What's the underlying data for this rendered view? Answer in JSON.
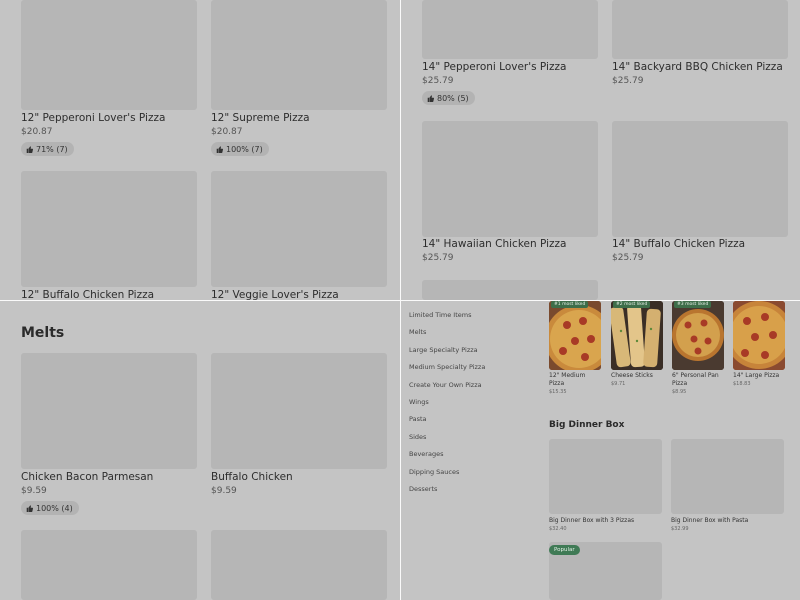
{
  "top_left": {
    "cards": [
      {
        "name": "12\" Pepperoni Lover's Pizza",
        "price": "$20.87",
        "rating": "71% (7)"
      },
      {
        "name": "12\" Supreme Pizza",
        "price": "$20.87",
        "rating": "100% (7)"
      },
      {
        "name": "12\" Buffalo Chicken Pizza"
      },
      {
        "name": "12\" Veggie Lover's Pizza"
      }
    ]
  },
  "top_right": {
    "cards": [
      {
        "name": "14\" Pepperoni Lover's Pizza",
        "price": "$25.79",
        "rating": "80% (5)"
      },
      {
        "name": "14\" Backyard BBQ Chicken Pizza",
        "price": "$25.79"
      },
      {
        "name": "14\" Hawaiian Chicken Pizza",
        "price": "$25.79"
      },
      {
        "name": "14\" Buffalo Chicken Pizza",
        "price": "$25.79"
      }
    ]
  },
  "bottom_left": {
    "section_title": "Melts",
    "cards": [
      {
        "name": "Chicken Bacon Parmesan",
        "price": "$9.59",
        "rating": "100% (4)"
      },
      {
        "name": "Buffalo Chicken",
        "price": "$9.59"
      }
    ]
  },
  "bottom_right": {
    "nav": [
      "Limited Time Items",
      "Melts",
      "Large Specialty Pizza",
      "Medium Specialty Pizza",
      "Create Your Own Pizza",
      "Wings",
      "Pasta",
      "Sides",
      "Beverages",
      "Dipping Sauces",
      "Desserts"
    ],
    "most_liked": [
      {
        "tag": "#1 most liked",
        "name": "12\" Medium Pizza",
        "price": "$15.35"
      },
      {
        "tag": "#2 most liked",
        "name": "Cheese Sticks",
        "price": "$9.71"
      },
      {
        "tag": "#3 most liked",
        "name": "6\" Personal Pan Pizza",
        "price": "$8.95"
      },
      {
        "tag": "",
        "name": "14\" Large Pizza",
        "price": "$18.83"
      }
    ],
    "section_title": "Big Dinner Box",
    "dinner_cards": [
      {
        "name": "Big Dinner Box with 3 Pizzas",
        "price": "$32.40"
      },
      {
        "name": "Big Dinner Box with Pasta",
        "price": "$32.99"
      }
    ],
    "popular_badge": "Popular"
  },
  "colors": {
    "background": "#c4c4c4",
    "placeholder": "#b6b6b6",
    "divider": "#fafafa",
    "tag_green": "#3e6e4a"
  }
}
